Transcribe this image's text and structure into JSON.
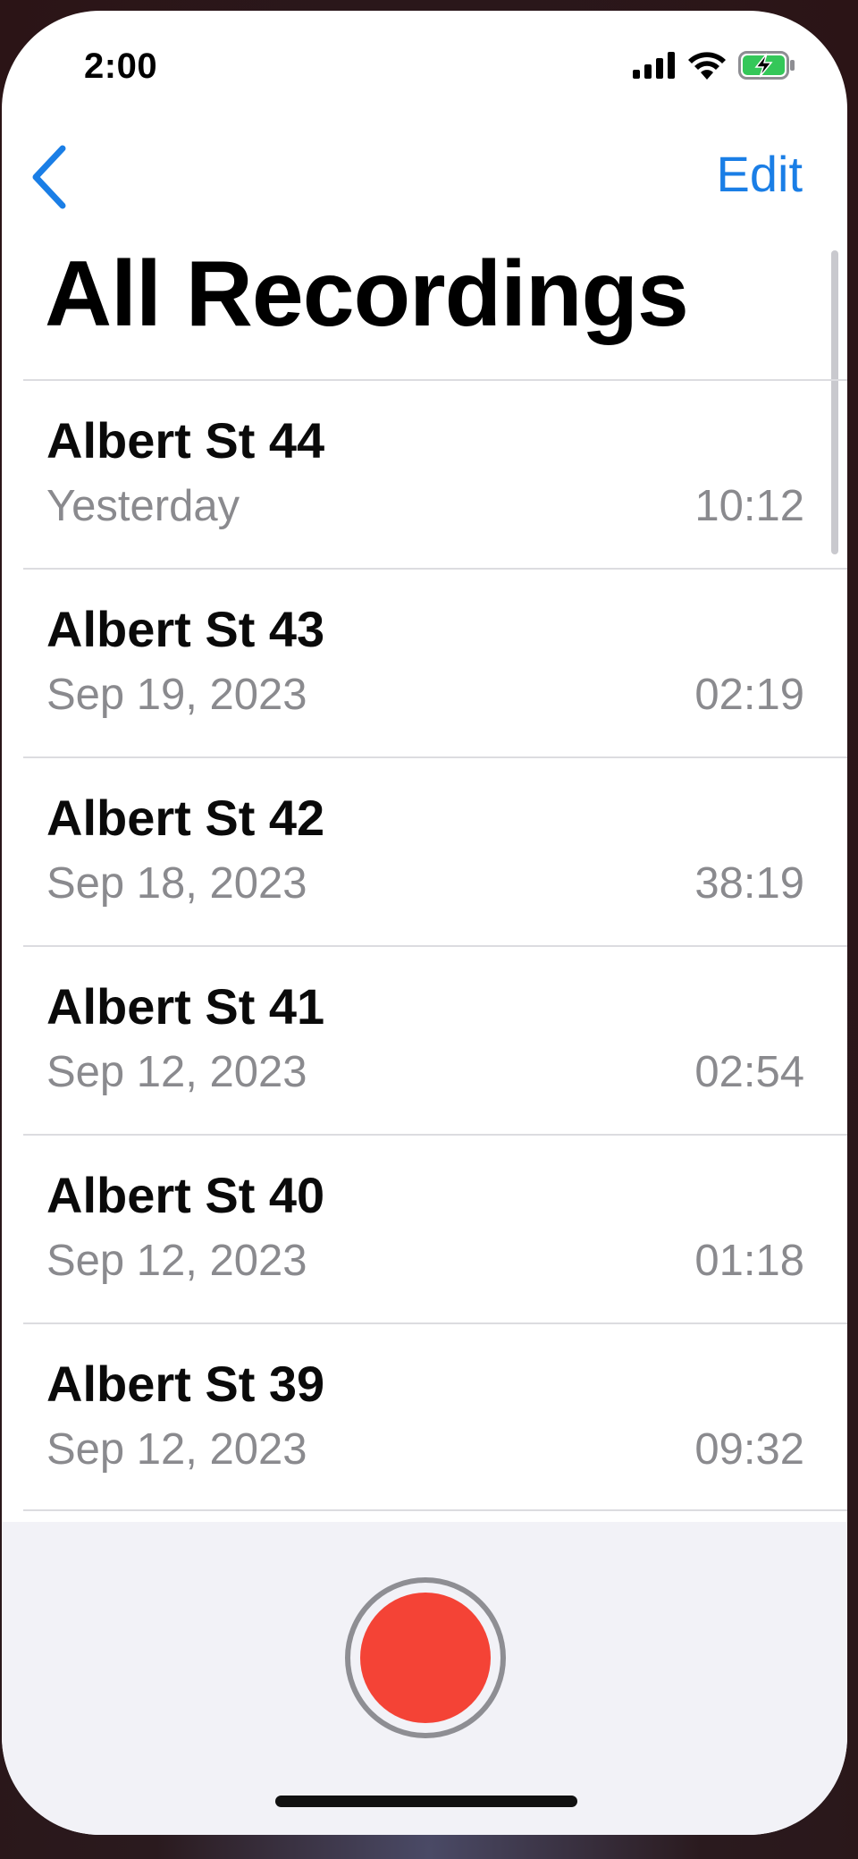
{
  "status_bar": {
    "time": "2:00",
    "icons": [
      "cellular-signal-icon",
      "wifi-icon",
      "battery-charging-icon"
    ],
    "battery_color": "#34c759"
  },
  "nav": {
    "back_icon": "chevron-left-icon",
    "edit_label": "Edit",
    "accent_color": "#1a7ee6"
  },
  "page": {
    "title": "All Recordings"
  },
  "recordings": [
    {
      "name": "Albert St 44",
      "date": "Yesterday",
      "duration": "10:12"
    },
    {
      "name": "Albert St 43",
      "date": "Sep 19, 2023",
      "duration": "02:19"
    },
    {
      "name": "Albert St 42",
      "date": "Sep 18, 2023",
      "duration": "38:19"
    },
    {
      "name": "Albert St 41",
      "date": "Sep 12, 2023",
      "duration": "02:54"
    },
    {
      "name": "Albert St 40",
      "date": "Sep 12, 2023",
      "duration": "01:18"
    },
    {
      "name": "Albert St 39",
      "date": "Sep 12, 2023",
      "duration": "09:32"
    }
  ],
  "record": {
    "icon": "record-icon",
    "color": "#f44336"
  }
}
